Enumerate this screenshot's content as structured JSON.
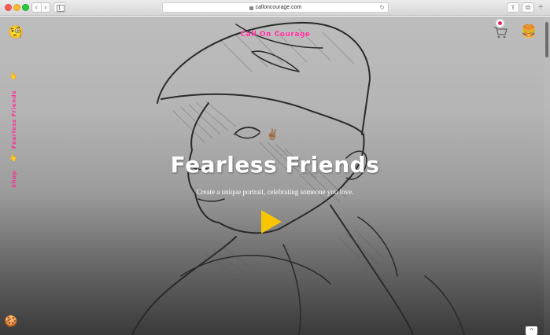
{
  "browser": {
    "url": "calloncourage.com",
    "nav_back": "‹",
    "nav_forward": "›",
    "reload": "↻",
    "share": "⇪",
    "tabs": "⧉",
    "new_tab": "+"
  },
  "header": {
    "brand": "Call On Courage"
  },
  "side_nav": {
    "items": [
      {
        "label": "Fearless Friends",
        "icon": "pointing-hand-icon"
      },
      {
        "label": "Shop",
        "icon": "pointing-hand-icon"
      }
    ],
    "hand_glyph": "👆"
  },
  "icons": {
    "top_emoji": "🧐",
    "cookie": "🍪",
    "burger": "🍔",
    "peace": "✌🏽"
  },
  "hero": {
    "title": "Fearless Friends",
    "subtitle": "Create a unique portrait, celebrating someone you love."
  },
  "scroll_top_glyph": "^",
  "colors": {
    "brand_pink": "#ff2d9a",
    "play_yellow": "#f7c600"
  }
}
